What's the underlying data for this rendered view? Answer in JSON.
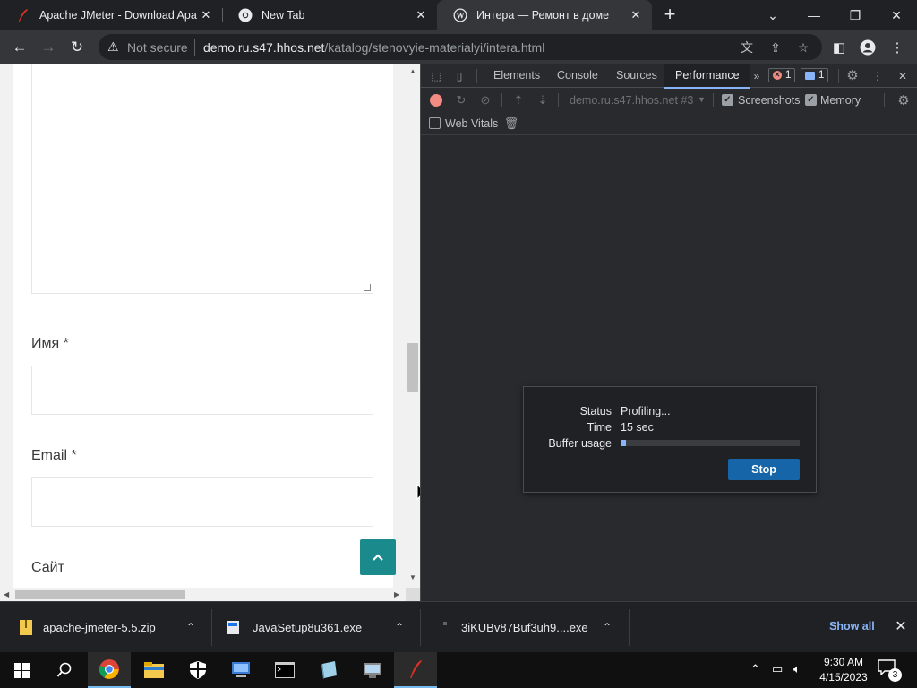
{
  "browser": {
    "tabs": [
      {
        "title": "Apache JMeter - Download Apac",
        "icon": "feather-icon",
        "active": false
      },
      {
        "title": "New Tab",
        "icon": "chrome-icon",
        "active": false
      },
      {
        "title": "Интера — Ремонт в доме",
        "icon": "wordpress-icon",
        "active": true
      }
    ],
    "new_tab_label": "+",
    "omnibox": {
      "security_label": "Not secure",
      "url_host": "demo.ru.s47.hhos.net",
      "url_path": "/katalog/stenovyie-materialyi/intera.html"
    }
  },
  "page": {
    "fields": [
      {
        "label": "Имя *",
        "value": ""
      },
      {
        "label": "Email *",
        "value": ""
      },
      {
        "label": "Сайт",
        "value": ""
      }
    ]
  },
  "devtools": {
    "tabs": [
      "Elements",
      "Console",
      "Sources",
      "Performance"
    ],
    "active_tab": "Performance",
    "error_count": "1",
    "message_count": "1",
    "target": "demo.ru.s47.hhos.net #3",
    "screenshots_label": "Screenshots",
    "screenshots_checked": true,
    "memory_label": "Memory",
    "memory_checked": true,
    "web_vitals_label": "Web Vitals",
    "web_vitals_checked": false,
    "profiling": {
      "status_label": "Status",
      "status_value": "Profiling...",
      "time_label": "Time",
      "time_value": "15 sec",
      "buffer_label": "Buffer usage",
      "buffer_fraction": 0.03,
      "stop_label": "Stop"
    }
  },
  "downloads": {
    "items": [
      {
        "name": "apache-jmeter-5.5.zip"
      },
      {
        "name": "JavaSetup8u361.exe"
      },
      {
        "name": "3iKUBv87Buf3uh9....exe"
      }
    ],
    "show_all_label": "Show all"
  },
  "taskbar": {
    "time": "9:30 AM",
    "date": "4/15/2023",
    "notification_count": "3"
  },
  "colors": {
    "accent": "#8ab4f8",
    "record": "#f28b82",
    "back_to_top": "#1b8a8c"
  }
}
